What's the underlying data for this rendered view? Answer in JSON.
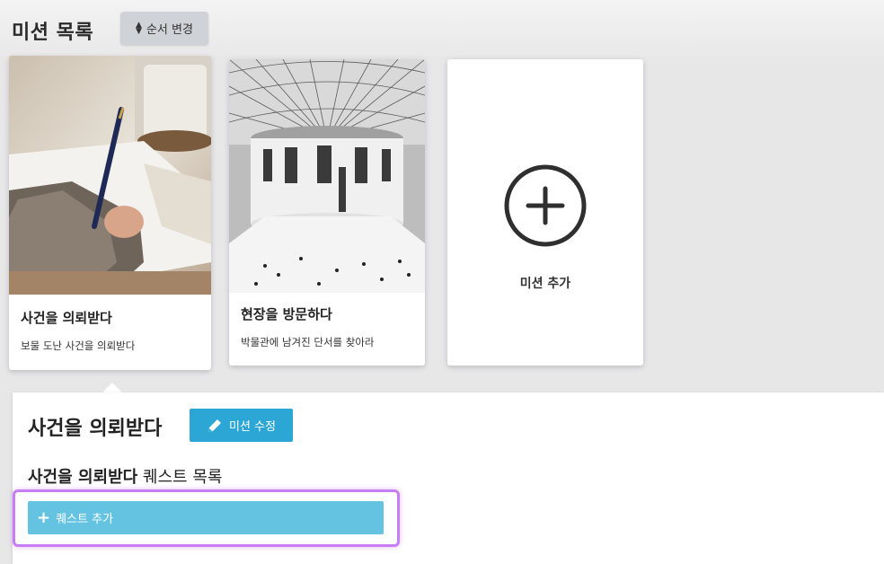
{
  "header": {
    "title": "미션 목록",
    "reorder_label": "순서 변경"
  },
  "missions": [
    {
      "title": "사건을 의뢰받다",
      "description": "보물 도난 사건을 의뢰받다"
    },
    {
      "title": "현장을 방문하다",
      "description": "박물관에 남겨진 단서를 찾아라"
    }
  ],
  "add_mission_label": "미션 추가",
  "detail": {
    "title": "사건을 의뢰받다",
    "edit_label": "미션 수정",
    "quest_list_mission": "사건을 의뢰받다",
    "quest_list_suffix": "퀘스트 목록",
    "add_quest_label": "퀘스트 추가"
  },
  "colors": {
    "accent": "#2ca6d4",
    "quest_button": "#65c3e2",
    "highlight": "#c77df3"
  }
}
